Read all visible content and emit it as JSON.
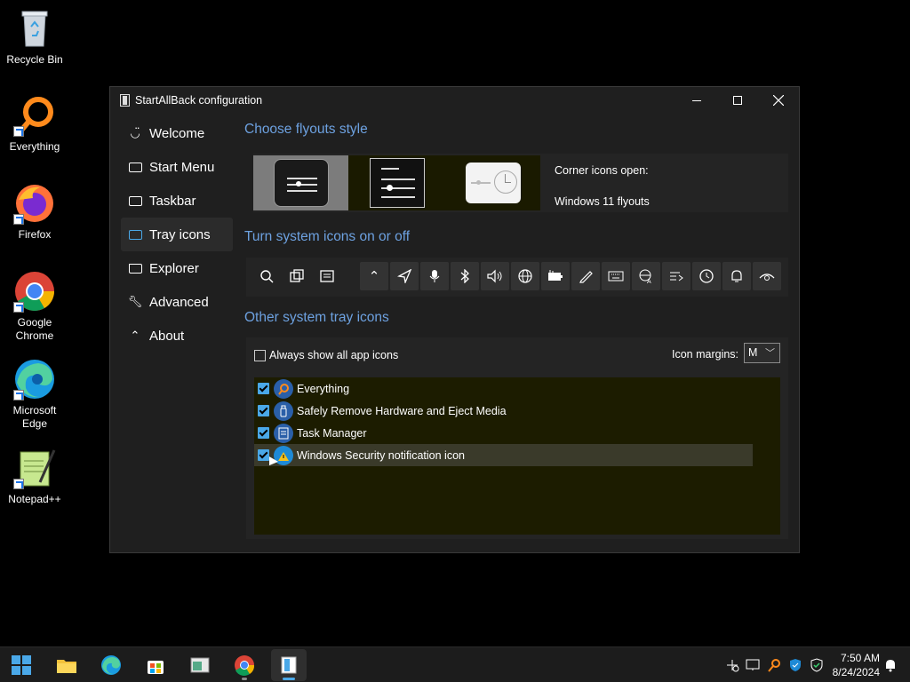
{
  "desktop": {
    "icons": [
      {
        "label": "Recycle Bin",
        "icon": "recycle-bin-icon"
      },
      {
        "label": "Everything",
        "icon": "everything-icon"
      },
      {
        "label": "Firefox",
        "icon": "firefox-icon"
      },
      {
        "label": "Google Chrome",
        "icon": "chrome-icon"
      },
      {
        "label": "Microsoft Edge",
        "icon": "edge-icon"
      },
      {
        "label": "Notepad++",
        "icon": "notepadpp-icon"
      }
    ]
  },
  "window": {
    "title": "StartAllBack configuration",
    "sidebar": [
      {
        "label": "Welcome",
        "icon": "smile-icon"
      },
      {
        "label": "Start Menu",
        "icon": "start-menu-icon"
      },
      {
        "label": "Taskbar",
        "icon": "taskbar-icon"
      },
      {
        "label": "Tray icons",
        "icon": "tray-icon",
        "active": true
      },
      {
        "label": "Explorer",
        "icon": "folder-icon"
      },
      {
        "label": "Advanced",
        "icon": "wrench-icon"
      },
      {
        "label": "About",
        "icon": "about-icon"
      }
    ],
    "flyouts": {
      "heading": "Choose flyouts style",
      "corner_label": "Corner icons open:",
      "corner_value": "Windows 11 flyouts"
    },
    "system_icons": {
      "heading": "Turn system icons on or off",
      "icons": [
        "search-icon",
        "task-view-icon",
        "widgets-icon",
        "chevron-up-icon",
        "location-icon",
        "microphone-icon",
        "bluetooth-icon",
        "volume-icon",
        "network-icon",
        "battery-icon",
        "pen-icon",
        "keyboard-icon",
        "language-icon",
        "input-icon",
        "clock-icon",
        "notification-icon",
        "visibility-icon"
      ]
    },
    "other_tray": {
      "heading": "Other system tray icons",
      "always_show_label": "Always show all app icons",
      "icon_margins_label": "Icon margins:",
      "icon_margins_value": "M",
      "items": [
        {
          "label": "Everything",
          "checked": true
        },
        {
          "label": "Safely Remove Hardware and Eject Media",
          "checked": true
        },
        {
          "label": "Task Manager",
          "checked": true
        },
        {
          "label": "Windows Security notification icon",
          "checked": true
        }
      ]
    }
  },
  "taskbar": {
    "time": "7:50 AM",
    "date": "8/24/2024"
  },
  "colors": {
    "accent": "#4aa8e8",
    "section_heading": "#6da1e0",
    "window_bg": "#1f1f1f"
  }
}
